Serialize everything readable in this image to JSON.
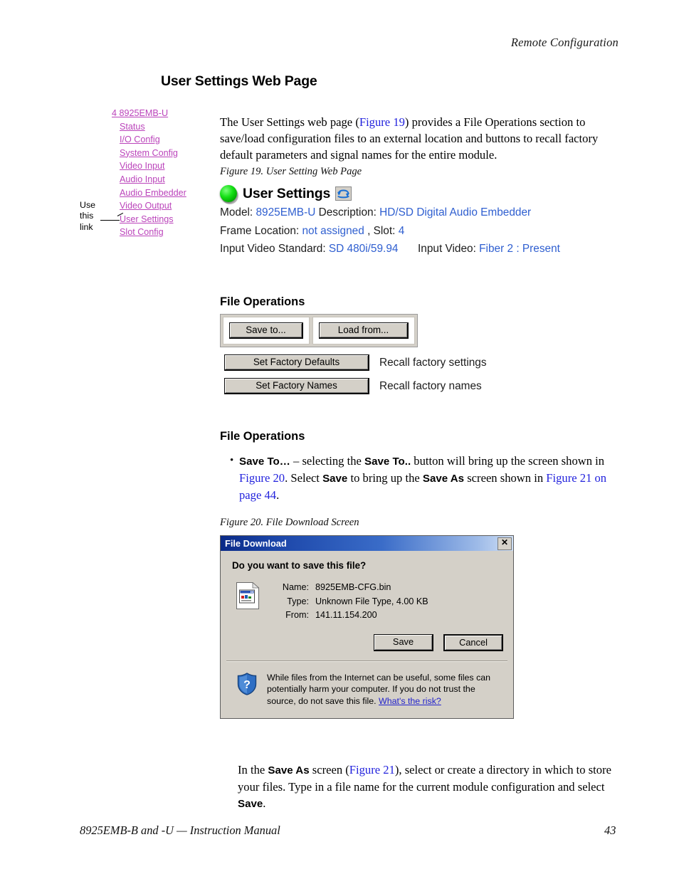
{
  "page": {
    "running_head": "Remote Configuration",
    "section_title": "User Settings Web Page",
    "footer_left": "8925EMB-B and -U — Instruction Manual",
    "footer_page_number": "43"
  },
  "intro": {
    "part1": "The User Settings web page (",
    "xref": "Figure 19",
    "part2": ") provides a File Operations section to save/load configuration files to an external location and buttons to recall factory default parameters and signal names for the entire module."
  },
  "nav": {
    "annotation": [
      "Use",
      "this",
      "link"
    ],
    "items": [
      {
        "label": "4 8925EMB-U"
      },
      {
        "label": "Status"
      },
      {
        "label": "I/O Config"
      },
      {
        "label": "System Config"
      },
      {
        "label": "Video Input"
      },
      {
        "label": "Audio Input"
      },
      {
        "label": "Audio Embedder"
      },
      {
        "label": "Video Output"
      },
      {
        "label": "User Settings"
      },
      {
        "label": "Slot Config"
      }
    ]
  },
  "figure19": {
    "caption": "Figure 19.  User Setting Web Page",
    "status_led": "green-led-icon",
    "title": "User Settings",
    "refresh_icon": "refresh-icon",
    "fields": {
      "model_label": "Model:",
      "model_value": "8925EMB-U",
      "description_label": "Description:",
      "description_value": "HD/SD Digital Audio Embedder",
      "frame_location_label": "Frame Location:",
      "frame_location_value": "not assigned",
      "slot_label": ", Slot:",
      "slot_value": "4",
      "input_video_standard_label": "Input Video Standard:",
      "input_video_standard_value": "SD 480i/59.94",
      "input_video_label": "Input Video:",
      "input_video_value": "Fiber 2 : Present"
    },
    "file_operations": {
      "heading": "File Operations",
      "save_to_button": "Save to...",
      "load_from_button": "Load from...",
      "set_factory_defaults_button": "Set Factory Defaults",
      "set_factory_defaults_desc": "Recall factory settings",
      "set_factory_names_button": "Set Factory Names",
      "set_factory_names_desc": "Recall factory names"
    }
  },
  "body": {
    "subhead": "File Operations",
    "bullet": {
      "term1": "Save To…",
      "text1": " – selecting the ",
      "term2": "Save To..",
      "text2": " button will bring up the screen shown in ",
      "xref1": "Figure 20",
      "text3": ". Select ",
      "term3": "Save",
      "text4": " to bring up the ",
      "term4": "Save As",
      "text5": " screen shown in ",
      "xref2": "Figure 21 on page 44",
      "text6": "."
    }
  },
  "figure20": {
    "caption": "Figure 20.  File Download Screen",
    "dialog": {
      "title": "File Download",
      "close_label": "✕",
      "question": "Do you want to save this file?",
      "file_icon": "file-icon",
      "rows": [
        {
          "label": "Name:",
          "value": "8925EMB-CFG.bin"
        },
        {
          "label": "Type:",
          "value": "Unknown File Type, 4.00 KB"
        },
        {
          "label": "From:",
          "value": "141.11.154.200"
        }
      ],
      "save_button": "Save",
      "cancel_button": "Cancel",
      "shield_icon": "shield-question-icon",
      "warning_text": "While files from the Internet can be useful, some files can potentially harm your computer. If you do not trust the source, do not save this file. ",
      "warning_link": "What's the risk?"
    }
  },
  "closing": {
    "text1": "In the ",
    "term1": "Save As",
    "text2": " screen (",
    "xref": "Figure 21",
    "text3": "), select or create a directory in which to store your files. Type in a file name for the current module configuration and select ",
    "term2": "Save",
    "text4": "."
  },
  "colors": {
    "link_magenta": "#bb44bb",
    "xref_blue": "#2222dd",
    "web_value_blue": "#2f5fd0",
    "led_green": "#15e015",
    "dialog_face": "#d4d0c8",
    "titlebar_blue": "#0a2a87"
  }
}
